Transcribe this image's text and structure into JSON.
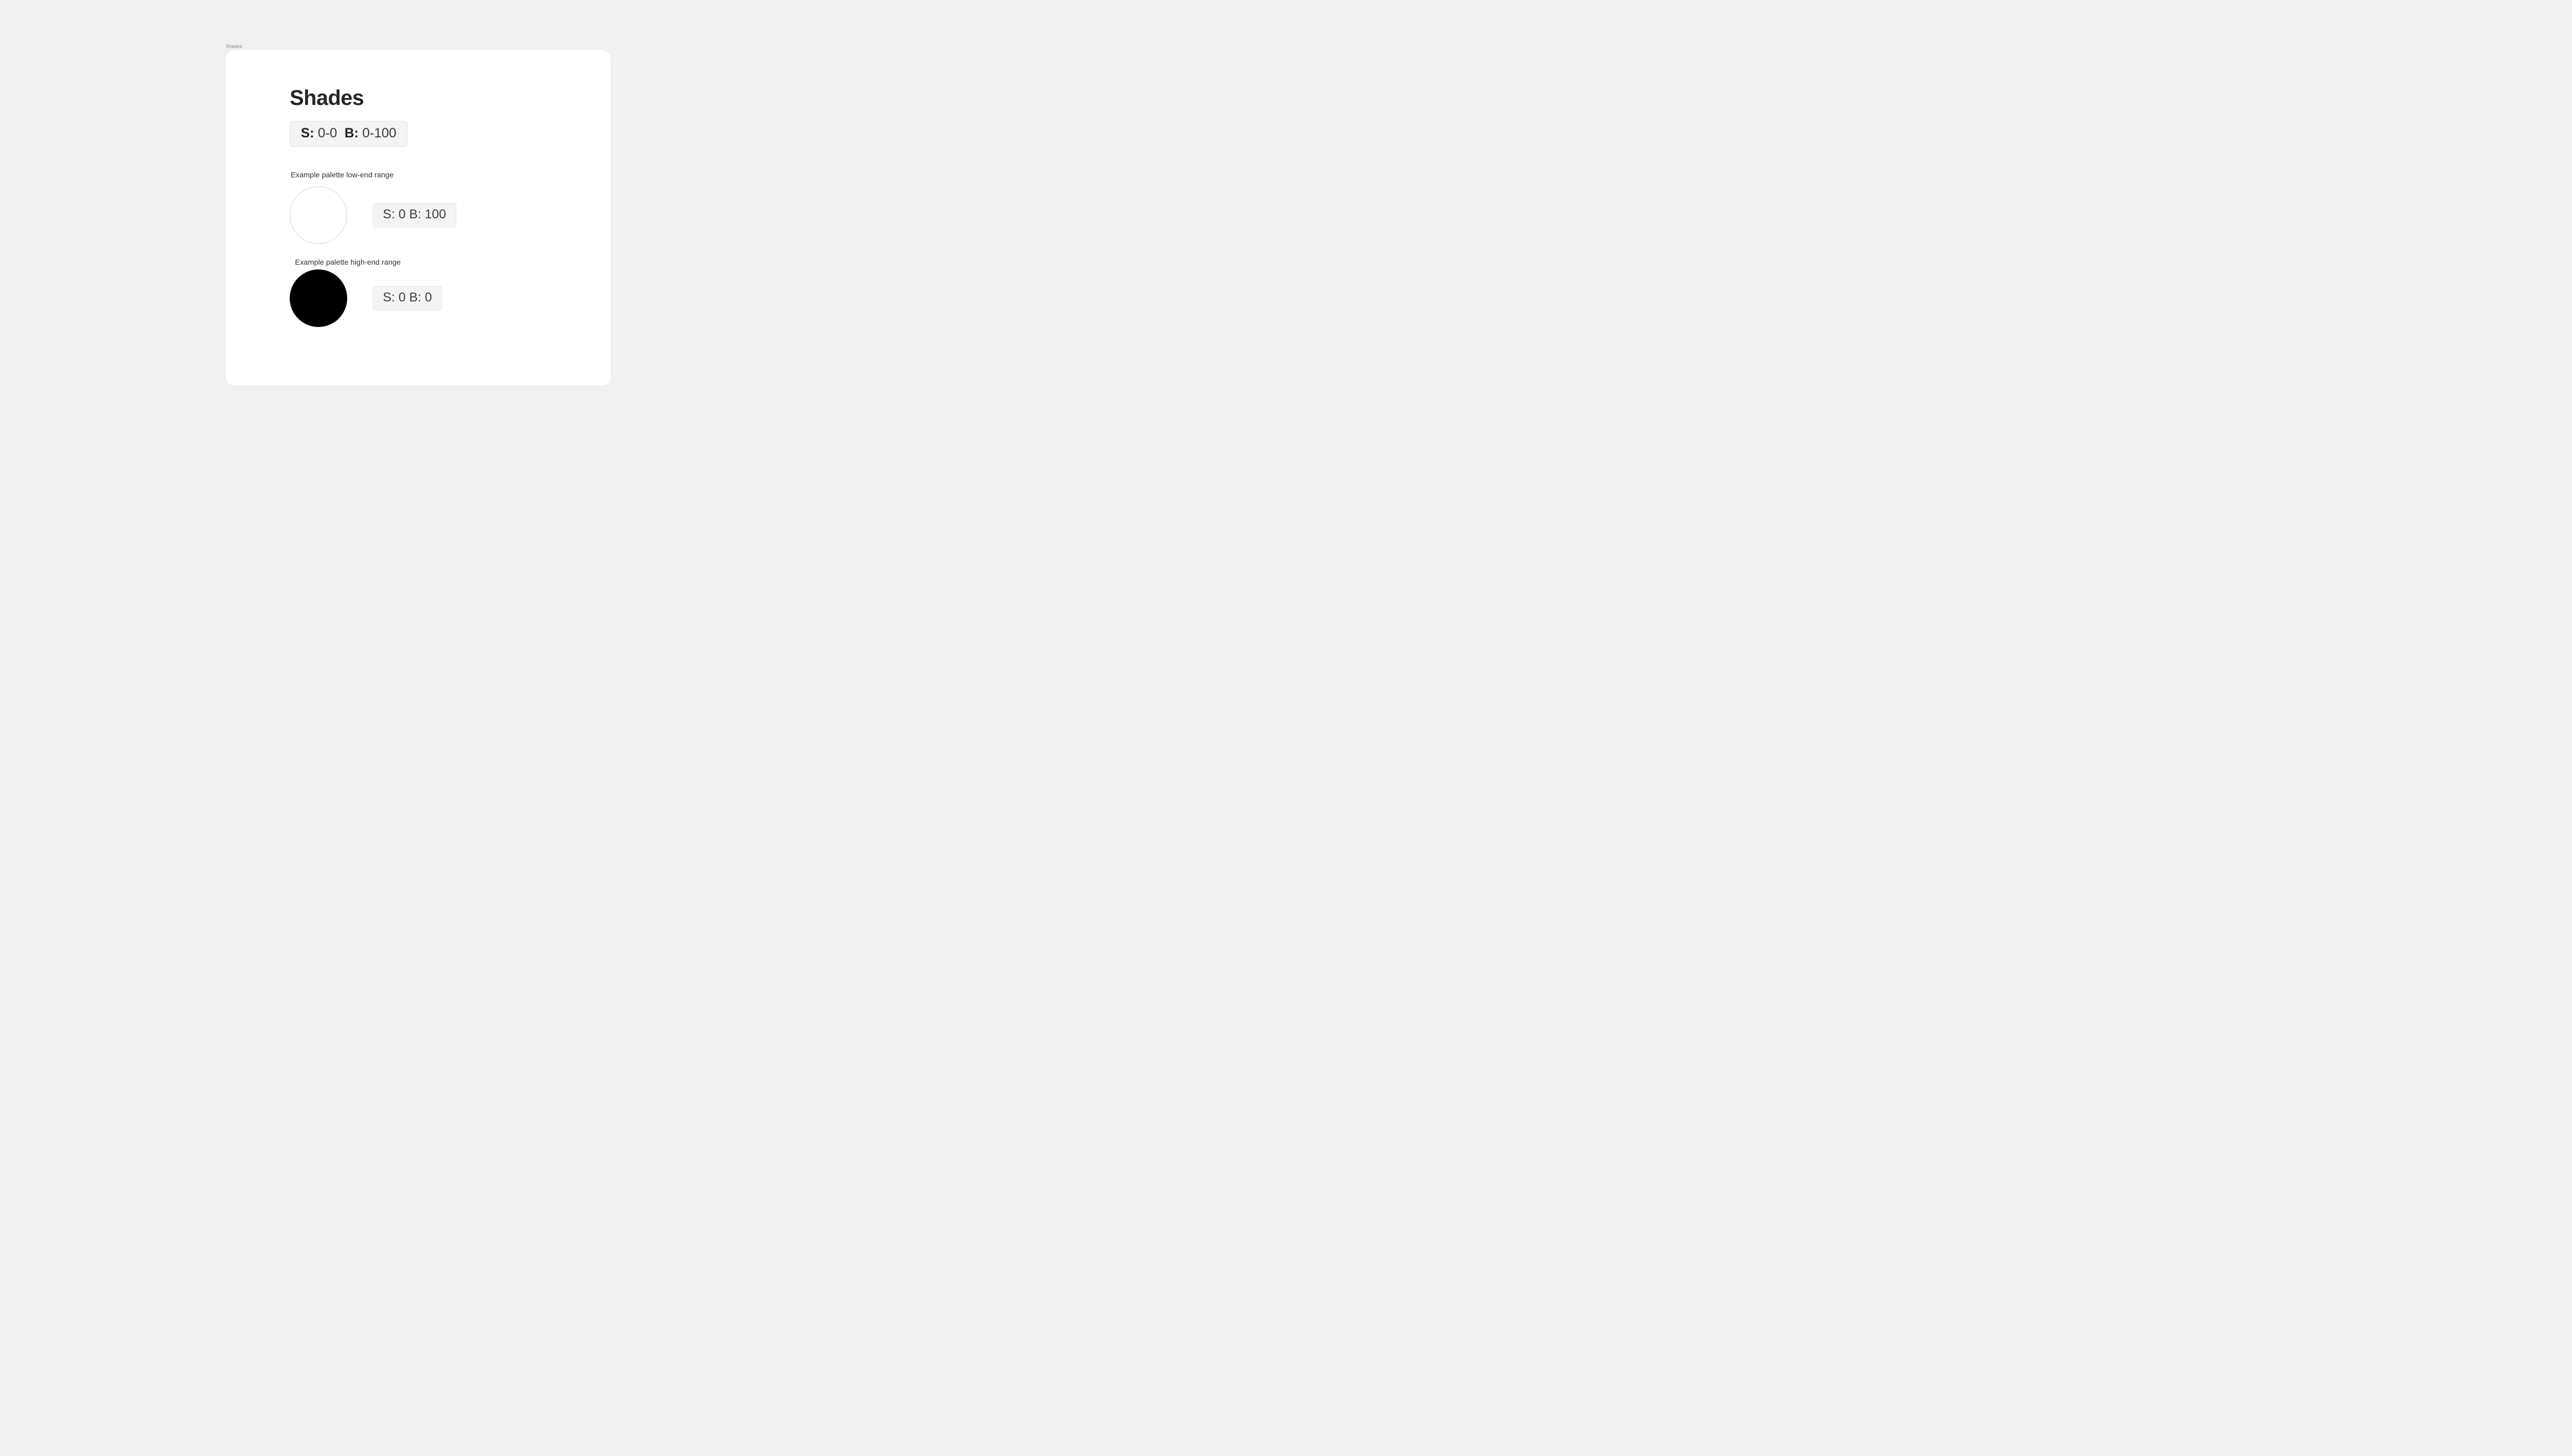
{
  "card_label": "Shades",
  "title": "Shades",
  "header_range": {
    "s_label": "S:",
    "s_value": "0-0",
    "b_label": "B:",
    "b_value": "0-100"
  },
  "low_end": {
    "label": "Example palette low-end range",
    "swatch_color": "#ffffff",
    "value_text": "S: 0  B: 100"
  },
  "high_end": {
    "label": "Example palette high-end range",
    "swatch_color": "#000000",
    "value_text": "S: 0 B: 0"
  }
}
